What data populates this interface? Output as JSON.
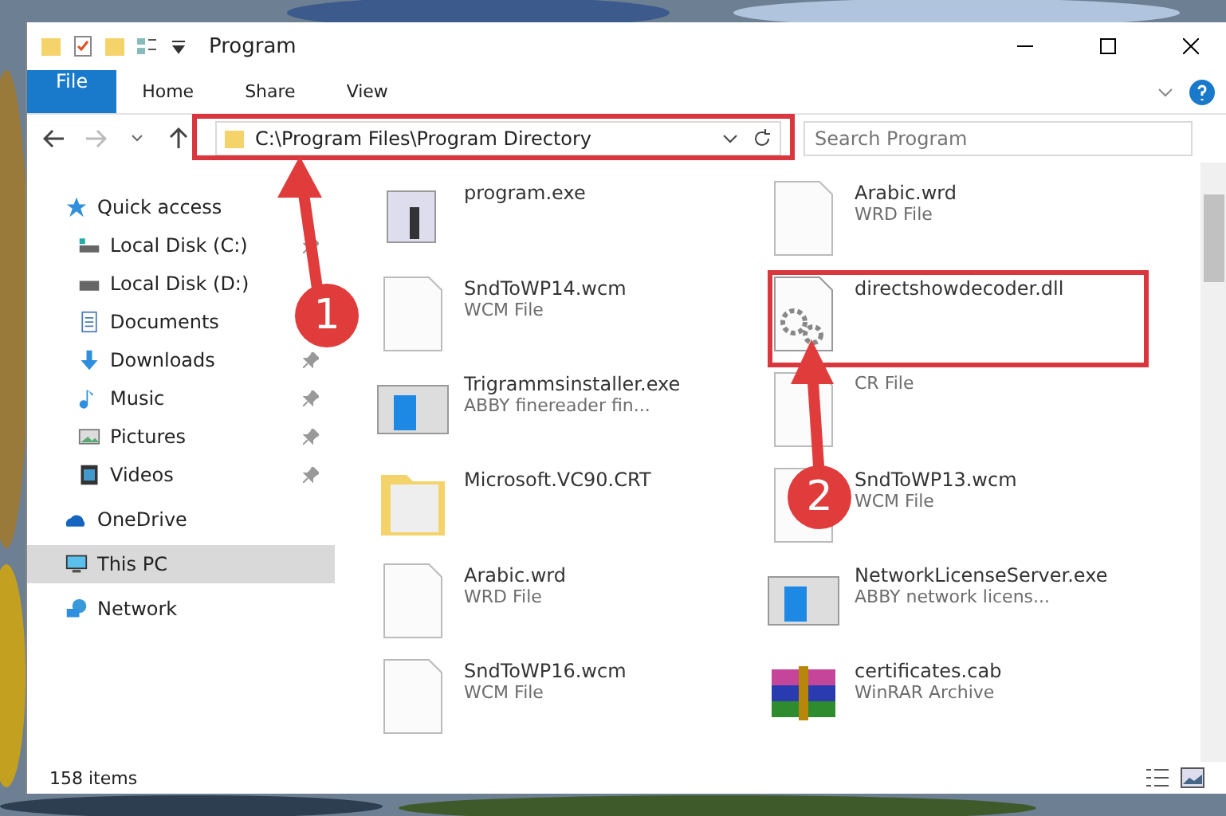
{
  "window": {
    "title": "Program"
  },
  "ribbon_tabs": [
    {
      "label": "File",
      "kind": "file"
    },
    {
      "label": "Home",
      "kind": "tab"
    },
    {
      "label": "Share",
      "kind": "tab"
    },
    {
      "label": "View",
      "kind": "tab"
    }
  ],
  "address_bar": {
    "path": "C:\\Program Files\\Program Directory"
  },
  "search": {
    "placeholder": "Search Program"
  },
  "sidebar": {
    "items": [
      {
        "label": "Quick access",
        "selected": false,
        "children": [
          {
            "label": "Local Disk (C:)",
            "pinned": true,
            "selected": false
          },
          {
            "label": "Local Disk (D:)",
            "pinned": false,
            "selected": false
          },
          {
            "label": "Documents",
            "pinned": false,
            "selected": false
          },
          {
            "label": "Downloads",
            "pinned": true,
            "selected": false
          },
          {
            "label": "Music",
            "pinned": true,
            "selected": false
          },
          {
            "label": "Pictures",
            "pinned": true,
            "selected": false
          },
          {
            "label": "Videos",
            "pinned": true,
            "selected": false
          }
        ]
      },
      {
        "label": "OneDrive",
        "selected": false
      },
      {
        "label": "This PC",
        "selected": true
      },
      {
        "label": "Network",
        "selected": false
      }
    ]
  },
  "files": [
    {
      "name": "program.exe",
      "kind": "exe"
    },
    {
      "name": "Arabic.wrd",
      "type": "WRD File",
      "kind": "doc"
    },
    {
      "name": "SndToWP14.wcm",
      "type": "WCM File",
      "kind": "doc"
    },
    {
      "name": "directshowdecoder.dll",
      "kind": "dll"
    },
    {
      "name": "Trigrammsinstaller.exe",
      "type": "ABBY finereader fin...",
      "kind": "app"
    },
    {
      "type": "CR File",
      "kind": "doc"
    },
    {
      "name": "Microsoft.VC90.CRT",
      "kind": "folder"
    },
    {
      "name": "SndToWP13.wcm",
      "type": "WCM File",
      "kind": "doc"
    },
    {
      "name": "Arabic.wrd",
      "type": "WRD File",
      "kind": "doc"
    },
    {
      "name": "NetworkLicenseServer.exe",
      "type": "ABBY network licens...",
      "kind": "app"
    },
    {
      "name": "SndToWP16.wcm",
      "type": "WCM File",
      "kind": "doc"
    },
    {
      "name": "certificates.cab",
      "type": "WinRAR Archive",
      "kind": "archive"
    }
  ],
  "status_bar": {
    "count": "158 items"
  },
  "annotations": [
    {
      "label": "1"
    },
    {
      "label": "2"
    }
  ]
}
